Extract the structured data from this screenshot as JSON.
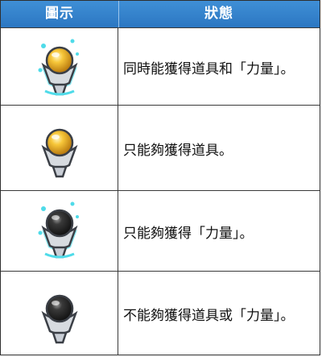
{
  "header": {
    "icon_col": "圖示",
    "state_col": "狀態"
  },
  "rows": [
    {
      "icon": "gold-orb-glow-icon",
      "state": "同時能獲得道具和「力量」。"
    },
    {
      "icon": "gold-orb-icon",
      "state": "只能夠獲得道具。"
    },
    {
      "icon": "black-orb-glow-icon",
      "state": "只能夠獲得「力量」。"
    },
    {
      "icon": "black-orb-icon",
      "state": "不能夠獲得道具或「力量」。"
    }
  ],
  "colors": {
    "header_bg": "#2c77c2",
    "gold": "#f2b21e",
    "black_orb": "#2a2a2a",
    "glow": "#2fd6e8"
  }
}
